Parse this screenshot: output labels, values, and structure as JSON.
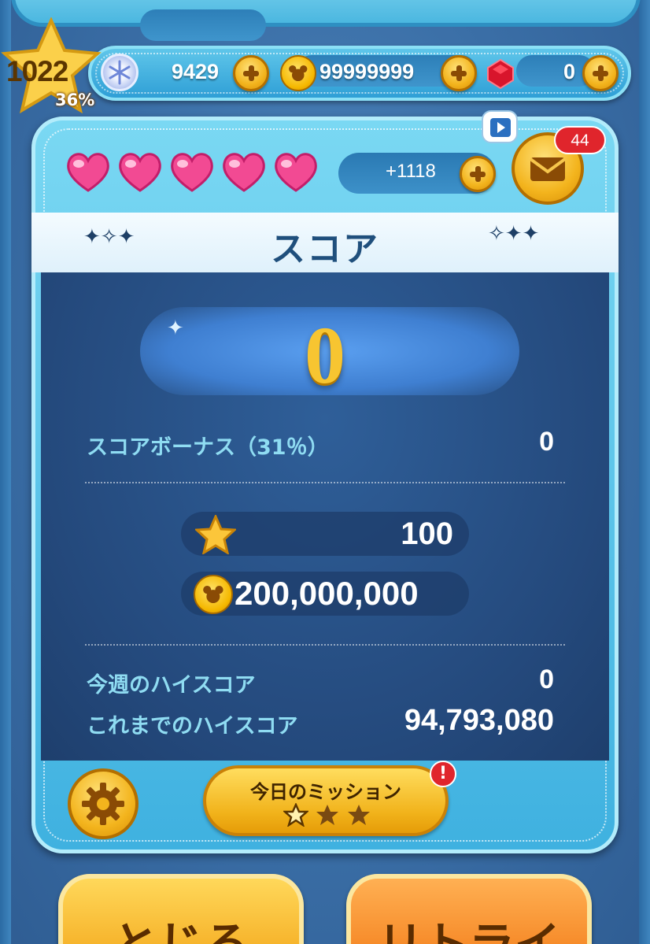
{
  "player": {
    "level": "1022",
    "level_progress": "36%"
  },
  "currencies": {
    "gems": "9429",
    "coins": "99999999",
    "rubies": "0"
  },
  "hearts": {
    "count": 5,
    "timer_text": "+1118"
  },
  "mail": {
    "badge_count": "44"
  },
  "score_panel": {
    "title": "スコア",
    "score": "0",
    "bonus_label": "スコアボーナス（31％）",
    "bonus_value": "0",
    "reward_star_value": "100",
    "reward_coin_value": "200,000,000",
    "weekly_high_label": "今週のハイスコア",
    "weekly_high_value": "0",
    "alltime_high_label": "これまでのハイスコア",
    "alltime_high_value": "94,793,080"
  },
  "mission": {
    "label": "今日のミッション",
    "alert": "!",
    "stars_earned": 1,
    "stars_total": 3
  },
  "buttons": {
    "close": "とじる",
    "retry": "リトライ"
  },
  "colors": {
    "gold": "#f3b41d",
    "score_gold": "#f7c531",
    "label_cyan": "#8fdcf2",
    "badge_red": "#e0252c"
  }
}
